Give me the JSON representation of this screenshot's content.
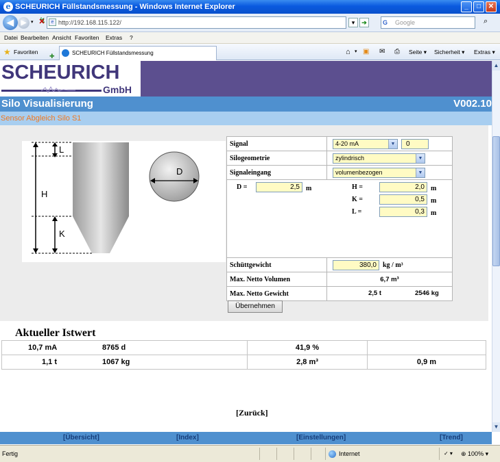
{
  "window": {
    "title": "SCHEURICH Füllstandsmessung - Windows Internet Explorer"
  },
  "address": {
    "url": "http://192.168.115.122/",
    "search_placeholder": "Google"
  },
  "menu": [
    "Datei",
    "Bearbeiten",
    "Ansicht",
    "Favoriten",
    "Extras",
    "?"
  ],
  "favbar": {
    "favorites_label": "Favoriten",
    "tab_title": "SCHEURICH Füllstandsmessung",
    "tools": [
      "Seite ▾",
      "Sicherheit ▾",
      "Extras ▾"
    ]
  },
  "logo": {
    "name": "SCHEURICH",
    "suffix": "GmbH"
  },
  "page": {
    "title": "Silo Visualisierung",
    "version": "V002.10",
    "subtitle": "Sensor Abgleich Silo S1"
  },
  "diagram": {
    "labels": {
      "L": "L",
      "H": "H",
      "K": "K",
      "D": "D"
    }
  },
  "settings": {
    "signal_label": "Signal",
    "signal_value": "4-20 mA",
    "signal_offset": "0",
    "geometry_label": "Silogeometrie",
    "geometry_value": "zylindrisch",
    "input_label": "Signaleingang",
    "input_value": "volumenbezogen",
    "dims": {
      "D_label": "D =",
      "D_value": "2,5",
      "D_unit": "m",
      "H_label": "H =",
      "H_value": "2,0",
      "H_unit": "m",
      "K_label": "K =",
      "K_value": "0,5",
      "K_unit": "m",
      "L_label": "L =",
      "L_value": "0,3",
      "L_unit": "m"
    },
    "bulk_label": "Schüttgewicht",
    "bulk_value": "380,0",
    "bulk_unit": "kg / m³",
    "max_volume_label": "Max. Netto Volumen",
    "max_volume_value": "6,7 m³",
    "max_weight_label": "Max. Netto Gewicht",
    "max_weight_t": "2,5 t",
    "max_weight_kg": "2546 kg",
    "apply_label": "Übernehmen"
  },
  "istwert": {
    "title": "Aktueller Istwert",
    "current": "10,7 mA",
    "days": "8765 d",
    "percent": "41,9 %",
    "weight_t": "1,1 t",
    "weight_kg": "1067 kg",
    "volume": "2,8 m³",
    "height": "0,9 m"
  },
  "back_link": "[Zurück]",
  "footer": [
    "[Übersicht]",
    "[Index]",
    "[Einstellungen]",
    "[Trend]"
  ],
  "status": {
    "text": "Fertig",
    "zone": "Internet",
    "zoom": "100%"
  },
  "colors": {
    "header_purple": "#5c4f8f",
    "title_blue": "#4f90cf",
    "subtitle_orange": "#f07820",
    "input_yellow": "#fffbc4"
  }
}
